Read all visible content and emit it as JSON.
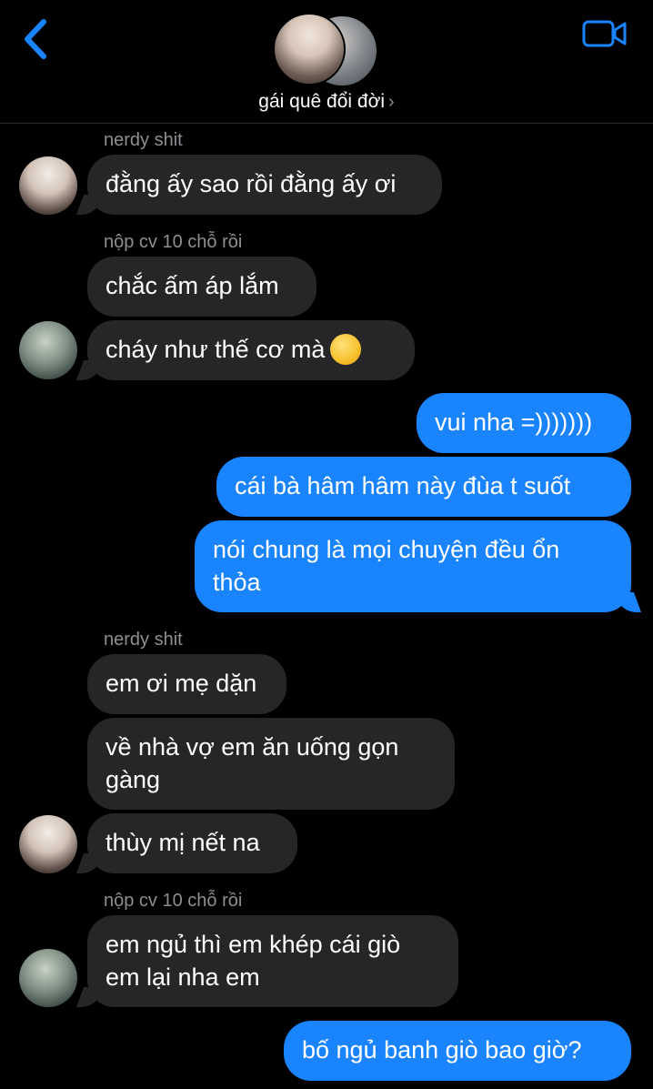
{
  "header": {
    "group_name": "gái quê đổi đời",
    "chevron": "›",
    "back_icon": "chevron-left-icon",
    "video_icon": "video-camera-icon",
    "accent": "#1a84ff"
  },
  "messages": [
    {
      "sender": "nerdy shit"
    },
    {
      "text": "đằng ấy sao rồi đằng ấy ơi"
    },
    {
      "sender": "nộp cv 10 chỗ rồi"
    },
    {
      "text": "chắc ấm áp lắm"
    },
    {
      "text": "cháy như thế cơ mà"
    },
    {
      "text": "vui nha =)))))))"
    },
    {
      "text": "cái bà hâm hâm này đùa t suốt"
    },
    {
      "text": "nói chung là mọi chuyện đều ổn\nthỏa"
    },
    {
      "sender": "nerdy shit"
    },
    {
      "text": "em ơi mẹ dặn"
    },
    {
      "text": "về nhà vợ em ăn uống gọn\ngàng"
    },
    {
      "text": "thùy mị nết na"
    },
    {
      "sender": "nộp cv 10 chỗ rồi"
    },
    {
      "text": "em ngủ thì em khép cái giò\nem lại nha em"
    },
    {
      "text": "bố ngủ banh giò bao giờ?"
    }
  ],
  "colors": {
    "incoming_bubble": "#262628",
    "outgoing_bubble": "#1a84ff",
    "sender_label": "#8e8e93",
    "background": "#000000"
  }
}
